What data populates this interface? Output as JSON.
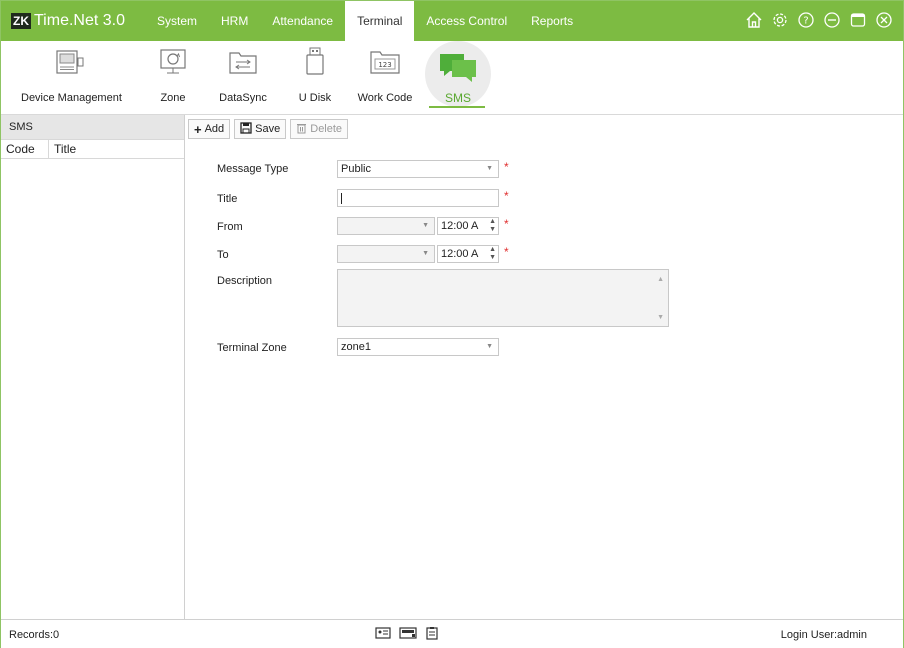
{
  "brand": {
    "logo": "ZK",
    "title": "Time.Net 3.0"
  },
  "nav": [
    {
      "label": "System"
    },
    {
      "label": "HRM"
    },
    {
      "label": "Attendance"
    },
    {
      "label": "Terminal",
      "active": true
    },
    {
      "label": "Access Control"
    },
    {
      "label": "Reports"
    }
  ],
  "window_icons": [
    "home-icon",
    "settings-icon",
    "help-icon",
    "minimize-icon",
    "maximize-icon",
    "close-icon"
  ],
  "ribbon": [
    {
      "label": "Device Management",
      "icon": "device-icon"
    },
    {
      "label": "Zone",
      "icon": "zone-icon"
    },
    {
      "label": "DataSync",
      "icon": "datasync-icon"
    },
    {
      "label": "U Disk",
      "icon": "udisk-icon"
    },
    {
      "label": "Work Code",
      "icon": "workcode-icon",
      "icon_text": "123"
    },
    {
      "label": "SMS",
      "icon": "sms-icon",
      "active": true
    }
  ],
  "left_panel": {
    "title": "SMS",
    "columns": [
      "Code",
      "Title"
    ]
  },
  "toolbar": {
    "add": "Add",
    "save": "Save",
    "delete": "Delete"
  },
  "form": {
    "message_type": {
      "label": "Message Type",
      "value": "Public"
    },
    "title": {
      "label": "Title",
      "value": ""
    },
    "from": {
      "label": "From",
      "date": "",
      "time": "12:00 A"
    },
    "to": {
      "label": "To",
      "date": "",
      "time": "12:00 A"
    },
    "description": {
      "label": "Description",
      "value": ""
    },
    "terminal_zone": {
      "label": "Terminal Zone",
      "value": "zone1"
    },
    "required_mark": "*"
  },
  "status": {
    "records": "Records:0",
    "login": "Login User:admin"
  },
  "colors": {
    "accent": "#7dbb42",
    "required": "#e03030"
  }
}
